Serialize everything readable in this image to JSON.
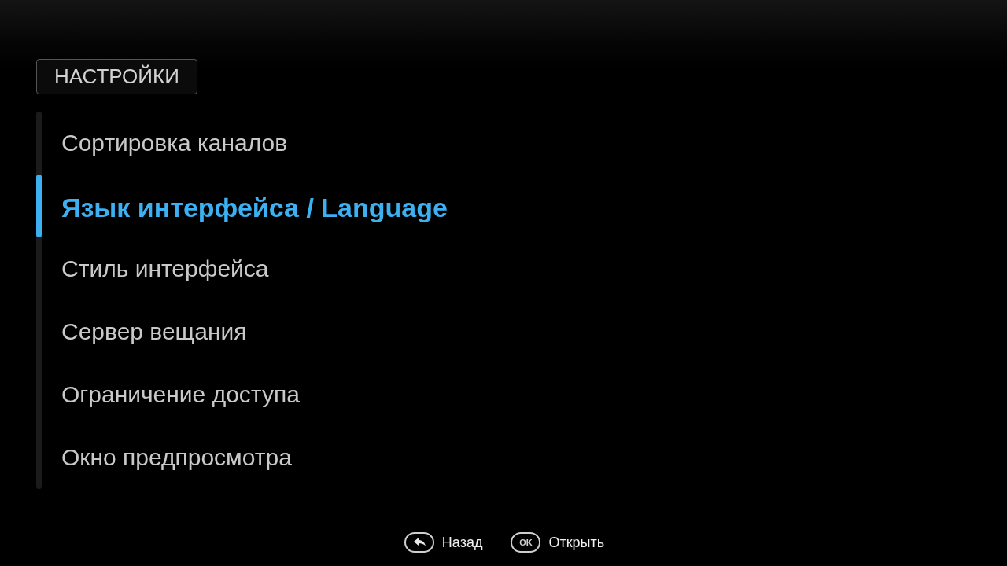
{
  "header": {
    "title": "НАСТРОЙКИ"
  },
  "menu": {
    "items": [
      {
        "label": "Сортировка каналов",
        "selected": false
      },
      {
        "label": "Язык интерфейса / Language",
        "selected": true
      },
      {
        "label": "Стиль интерфейса",
        "selected": false
      },
      {
        "label": "Сервер вещания",
        "selected": false
      },
      {
        "label": "Ограничение доступа",
        "selected": false
      },
      {
        "label": "Окно предпросмотра",
        "selected": false
      }
    ]
  },
  "hints": [
    {
      "kind": "back",
      "label": "Назад"
    },
    {
      "kind": "ok",
      "key": "OK",
      "label": "Открыть"
    }
  ]
}
